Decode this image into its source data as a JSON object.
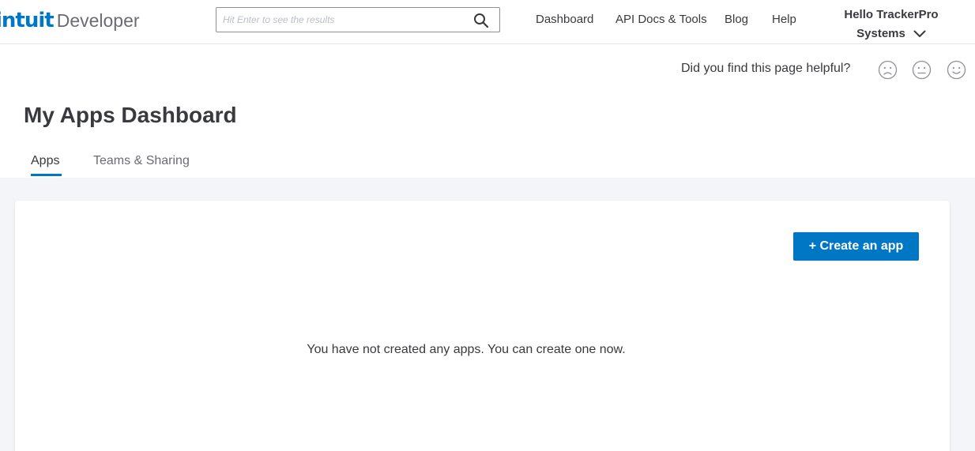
{
  "header": {
    "logo_brand": "intuit",
    "logo_product": "Developer",
    "search_placeholder": "Hit Enter to see the results",
    "search_value": "",
    "nav": {
      "dashboard": "Dashboard",
      "api_docs": "API Docs & Tools",
      "blog": "Blog",
      "help": "Help"
    },
    "user": {
      "line1": "Hello TrackerPro",
      "line2": "Systems"
    }
  },
  "feedback": {
    "question": "Did you find this page helpful?"
  },
  "page": {
    "title": "My Apps Dashboard",
    "tabs": {
      "apps": "Apps",
      "teams": "Teams & Sharing"
    }
  },
  "card": {
    "create_button": "+ Create an app",
    "empty_message": "You have not created any apps. You can create one now."
  },
  "colors": {
    "accent": "#0077c5",
    "text": "#393a3d",
    "background": "#f4f5f8"
  }
}
